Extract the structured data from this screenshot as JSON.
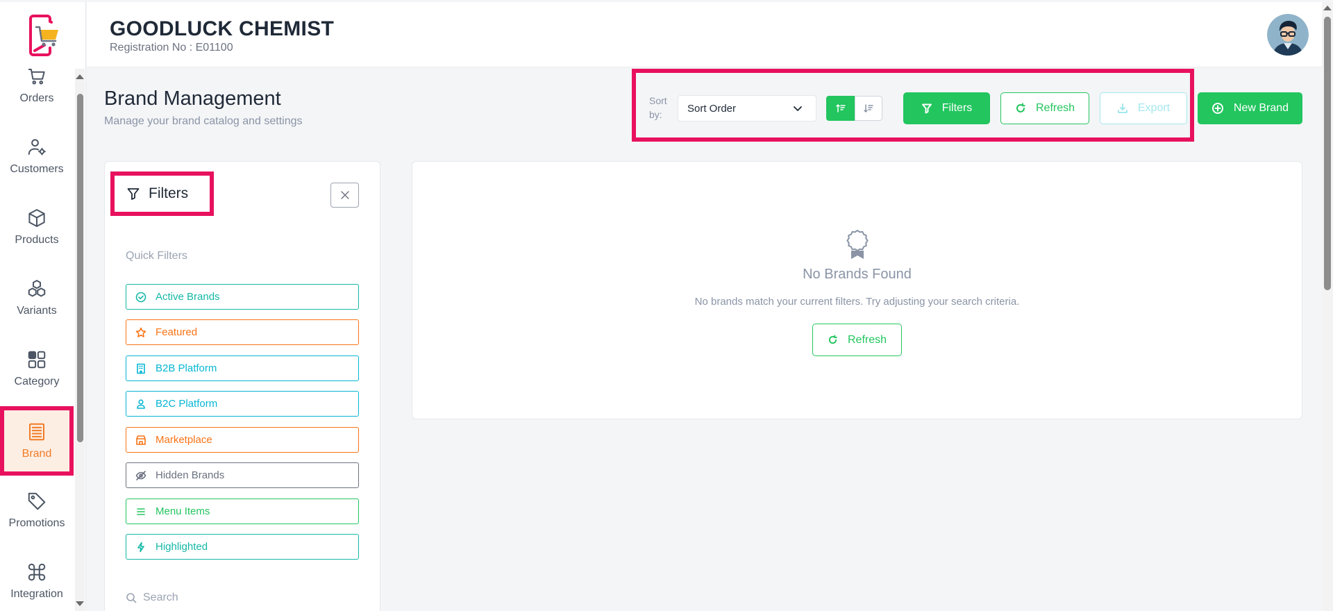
{
  "header": {
    "store_name": "GOODLUCK CHEMIST",
    "registration": "Registration No : E01100"
  },
  "sidebar": {
    "items": [
      {
        "label": "Orders",
        "icon": "cart-icon"
      },
      {
        "label": "Customers",
        "icon": "user-gear-icon"
      },
      {
        "label": "Products",
        "icon": "box-icon"
      },
      {
        "label": "Variants",
        "icon": "cubes-icon"
      },
      {
        "label": "Category",
        "icon": "grid-icon"
      },
      {
        "label": "Brand",
        "icon": "newspaper-icon",
        "active": true
      },
      {
        "label": "Promotions",
        "icon": "tag-icon"
      },
      {
        "label": "Integration",
        "icon": "command-icon"
      }
    ]
  },
  "page": {
    "title": "Brand Management",
    "subtitle": "Manage your brand catalog and settings"
  },
  "toolbar": {
    "sort_label": "Sort by:",
    "sort_value": "Sort Order",
    "filters_label": "Filters",
    "refresh_label": "Refresh",
    "export_label": "Export",
    "new_label": "New Brand"
  },
  "filters": {
    "title": "Filters",
    "quick_label": "Quick Filters",
    "quick": [
      {
        "label": "Active Brands",
        "icon": "check-circle-icon",
        "color": "#14b8a6"
      },
      {
        "label": "Featured",
        "icon": "star-icon",
        "color": "#f97316"
      },
      {
        "label": "B2B Platform",
        "icon": "building-icon",
        "color": "#06b6d4"
      },
      {
        "label": "B2C Platform",
        "icon": "person-icon",
        "color": "#06b6d4"
      },
      {
        "label": "Marketplace",
        "icon": "shop-icon",
        "color": "#f97316"
      },
      {
        "label": "Hidden Brands",
        "icon": "eye-off-icon",
        "color": "#6b7280"
      },
      {
        "label": "Menu Items",
        "icon": "list-icon",
        "color": "#22c55e"
      },
      {
        "label": "Highlighted",
        "icon": "bolt-icon",
        "color": "#14b8a6"
      }
    ],
    "search_label": "Search"
  },
  "empty": {
    "title": "No Brands Found",
    "description": "No brands match your current filters. Try adjusting your search criteria.",
    "refresh_label": "Refresh"
  },
  "colors": {
    "accent": "#22c55e",
    "highlight": "#e8115e",
    "active_nav": "#f07b26"
  }
}
